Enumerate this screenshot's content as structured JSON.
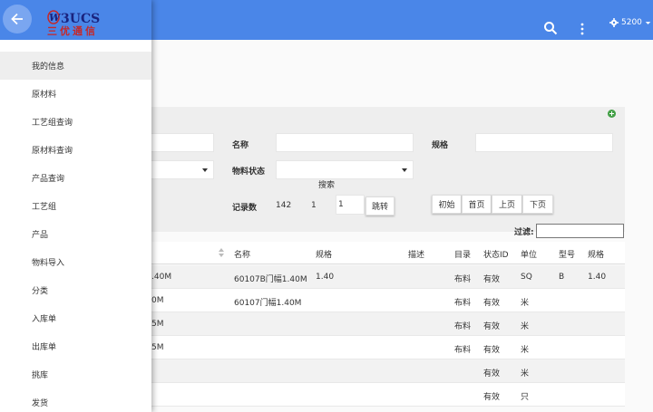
{
  "header": {
    "user_label": "5200"
  },
  "drawer": {
    "logo_text": "3UCS",
    "logo_subtext": "三优通信",
    "items": [
      {
        "label": "我的信息"
      },
      {
        "label": "原材料"
      },
      {
        "label": "工艺组查询"
      },
      {
        "label": "原材料查询"
      },
      {
        "label": "产品查询"
      },
      {
        "label": "工艺组"
      },
      {
        "label": "产品"
      },
      {
        "label": "物料导入"
      },
      {
        "label": "分类"
      },
      {
        "label": "入库单"
      },
      {
        "label": "出库单"
      },
      {
        "label": "挑库"
      },
      {
        "label": "发货"
      }
    ]
  },
  "search_panel": {
    "title": "搜索",
    "name_label": "名称",
    "spec_label": "规格",
    "status_label": "物料状态"
  },
  "pager": {
    "record_label": "记录数",
    "record_count": "142",
    "page_current": "1",
    "page_input": "1",
    "jump_label": "跳转",
    "first_label": "初始",
    "home_label": "首页",
    "prev_label": "上页",
    "next_label": "下页"
  },
  "filter": {
    "label": "过滤:"
  },
  "table": {
    "headers": [
      "名称",
      "规格",
      "描述",
      "目录",
      "状态ID",
      "单位",
      "型号",
      "规格"
    ],
    "rows": [
      {
        "frag": ".40M",
        "name": "60107B门幅1.40M",
        "spec": "1.40",
        "desc": "",
        "cat": "布料",
        "status": "有效",
        "unit": "SQ",
        "model": "B",
        "spec2": "1.40"
      },
      {
        "frag": "0M",
        "name": "60107门幅1.40M",
        "spec": "",
        "desc": "",
        "cat": "布料",
        "status": "有效",
        "unit": "米",
        "model": "",
        "spec2": ""
      },
      {
        "frag": "5M",
        "name": "",
        "spec": "",
        "desc": "",
        "cat": "布料",
        "status": "有效",
        "unit": "米",
        "model": "",
        "spec2": ""
      },
      {
        "frag": "5M",
        "name": "",
        "spec": "",
        "desc": "",
        "cat": "布料",
        "status": "有效",
        "unit": "米",
        "model": "",
        "spec2": ""
      },
      {
        "frag": "",
        "name": "",
        "spec": "",
        "desc": "",
        "cat": "",
        "status": "有效",
        "unit": "米",
        "model": "",
        "spec2": ""
      },
      {
        "frag": "",
        "name": "",
        "spec": "",
        "desc": "",
        "cat": "",
        "status": "有效",
        "unit": "只",
        "model": "",
        "spec2": ""
      }
    ]
  },
  "colors": {
    "primary": "#4a86e8",
    "back_button": "#7aa6f0",
    "add_icon": "#43a047"
  }
}
